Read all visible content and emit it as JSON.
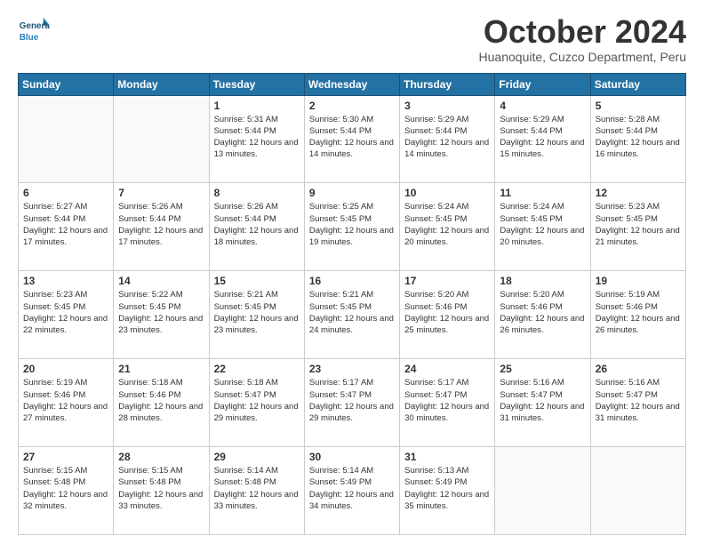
{
  "logo": {
    "line1": "General",
    "line2": "Blue"
  },
  "header": {
    "month": "October 2024",
    "location": "Huanoquite, Cuzco Department, Peru"
  },
  "days_of_week": [
    "Sunday",
    "Monday",
    "Tuesday",
    "Wednesday",
    "Thursday",
    "Friday",
    "Saturday"
  ],
  "weeks": [
    [
      {
        "day": "",
        "empty": true
      },
      {
        "day": "",
        "empty": true
      },
      {
        "day": "1",
        "sunrise": "5:31 AM",
        "sunset": "5:44 PM",
        "daylight": "12 hours and 13 minutes."
      },
      {
        "day": "2",
        "sunrise": "5:30 AM",
        "sunset": "5:44 PM",
        "daylight": "12 hours and 14 minutes."
      },
      {
        "day": "3",
        "sunrise": "5:29 AM",
        "sunset": "5:44 PM",
        "daylight": "12 hours and 14 minutes."
      },
      {
        "day": "4",
        "sunrise": "5:29 AM",
        "sunset": "5:44 PM",
        "daylight": "12 hours and 15 minutes."
      },
      {
        "day": "5",
        "sunrise": "5:28 AM",
        "sunset": "5:44 PM",
        "daylight": "12 hours and 16 minutes."
      }
    ],
    [
      {
        "day": "6",
        "sunrise": "5:27 AM",
        "sunset": "5:44 PM",
        "daylight": "12 hours and 17 minutes."
      },
      {
        "day": "7",
        "sunrise": "5:26 AM",
        "sunset": "5:44 PM",
        "daylight": "12 hours and 17 minutes."
      },
      {
        "day": "8",
        "sunrise": "5:26 AM",
        "sunset": "5:44 PM",
        "daylight": "12 hours and 18 minutes."
      },
      {
        "day": "9",
        "sunrise": "5:25 AM",
        "sunset": "5:45 PM",
        "daylight": "12 hours and 19 minutes."
      },
      {
        "day": "10",
        "sunrise": "5:24 AM",
        "sunset": "5:45 PM",
        "daylight": "12 hours and 20 minutes."
      },
      {
        "day": "11",
        "sunrise": "5:24 AM",
        "sunset": "5:45 PM",
        "daylight": "12 hours and 20 minutes."
      },
      {
        "day": "12",
        "sunrise": "5:23 AM",
        "sunset": "5:45 PM",
        "daylight": "12 hours and 21 minutes."
      }
    ],
    [
      {
        "day": "13",
        "sunrise": "5:23 AM",
        "sunset": "5:45 PM",
        "daylight": "12 hours and 22 minutes."
      },
      {
        "day": "14",
        "sunrise": "5:22 AM",
        "sunset": "5:45 PM",
        "daylight": "12 hours and 23 minutes."
      },
      {
        "day": "15",
        "sunrise": "5:21 AM",
        "sunset": "5:45 PM",
        "daylight": "12 hours and 23 minutes."
      },
      {
        "day": "16",
        "sunrise": "5:21 AM",
        "sunset": "5:45 PM",
        "daylight": "12 hours and 24 minutes."
      },
      {
        "day": "17",
        "sunrise": "5:20 AM",
        "sunset": "5:46 PM",
        "daylight": "12 hours and 25 minutes."
      },
      {
        "day": "18",
        "sunrise": "5:20 AM",
        "sunset": "5:46 PM",
        "daylight": "12 hours and 26 minutes."
      },
      {
        "day": "19",
        "sunrise": "5:19 AM",
        "sunset": "5:46 PM",
        "daylight": "12 hours and 26 minutes."
      }
    ],
    [
      {
        "day": "20",
        "sunrise": "5:19 AM",
        "sunset": "5:46 PM",
        "daylight": "12 hours and 27 minutes."
      },
      {
        "day": "21",
        "sunrise": "5:18 AM",
        "sunset": "5:46 PM",
        "daylight": "12 hours and 28 minutes."
      },
      {
        "day": "22",
        "sunrise": "5:18 AM",
        "sunset": "5:47 PM",
        "daylight": "12 hours and 29 minutes."
      },
      {
        "day": "23",
        "sunrise": "5:17 AM",
        "sunset": "5:47 PM",
        "daylight": "12 hours and 29 minutes."
      },
      {
        "day": "24",
        "sunrise": "5:17 AM",
        "sunset": "5:47 PM",
        "daylight": "12 hours and 30 minutes."
      },
      {
        "day": "25",
        "sunrise": "5:16 AM",
        "sunset": "5:47 PM",
        "daylight": "12 hours and 31 minutes."
      },
      {
        "day": "26",
        "sunrise": "5:16 AM",
        "sunset": "5:47 PM",
        "daylight": "12 hours and 31 minutes."
      }
    ],
    [
      {
        "day": "27",
        "sunrise": "5:15 AM",
        "sunset": "5:48 PM",
        "daylight": "12 hours and 32 minutes."
      },
      {
        "day": "28",
        "sunrise": "5:15 AM",
        "sunset": "5:48 PM",
        "daylight": "12 hours and 33 minutes."
      },
      {
        "day": "29",
        "sunrise": "5:14 AM",
        "sunset": "5:48 PM",
        "daylight": "12 hours and 33 minutes."
      },
      {
        "day": "30",
        "sunrise": "5:14 AM",
        "sunset": "5:49 PM",
        "daylight": "12 hours and 34 minutes."
      },
      {
        "day": "31",
        "sunrise": "5:13 AM",
        "sunset": "5:49 PM",
        "daylight": "12 hours and 35 minutes."
      },
      {
        "day": "",
        "empty": true
      },
      {
        "day": "",
        "empty": true
      }
    ]
  ]
}
